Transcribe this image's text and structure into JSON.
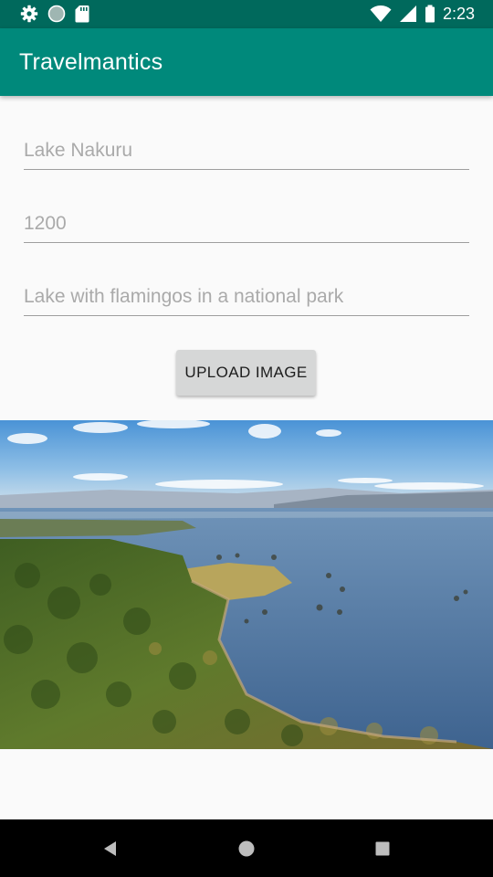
{
  "status_bar": {
    "time": "2:23",
    "icons": [
      "settings-icon",
      "circle-icon",
      "sd-card-icon",
      "wifi-icon",
      "signal-icon",
      "battery-icon"
    ]
  },
  "app_bar": {
    "title": "Travelmantics",
    "background": "#00897b",
    "status_color": "#00695c"
  },
  "form": {
    "title_placeholder": "Lake Nakuru",
    "price_placeholder": "1200",
    "description_placeholder": "Lake with flamingos in a national park",
    "upload_label": "UPLOAD IMAGE"
  },
  "nav_bar": {
    "icons": [
      "back-icon",
      "home-icon",
      "recents-icon"
    ]
  }
}
